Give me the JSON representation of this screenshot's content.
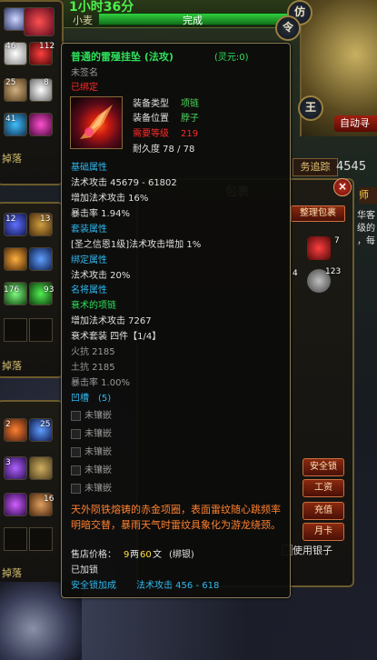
{
  "colors": {
    "title": "#2ee05a",
    "section": "#30b8f0",
    "required_level": "#ff2a2a",
    "description": "#ff8030",
    "price": "#ffe040"
  },
  "top_quest": {
    "timer": "1小时36分",
    "name": "小麦",
    "status": "完成"
  },
  "minimap": {
    "buttons": [
      "仿",
      "令",
      "王"
    ],
    "auto_button": "自动寻",
    "trace_tab": "务追踪",
    "number": "4545"
  },
  "bag": {
    "title": "包裹",
    "sort_button": "整理包裹",
    "tab1": "",
    "tab2": ""
  },
  "left_panel": {
    "drop_label_1": "掉落",
    "drop_label_2": "掉落",
    "drop_label_3": "掉落",
    "counts_top": [
      "46",
      "112",
      "25",
      "8",
      "41"
    ],
    "counts_mid": [
      "12",
      "13",
      "176",
      "93"
    ],
    "counts_bottom": [
      "2",
      "25",
      "3",
      "16"
    ]
  },
  "bag_counts": [
    "4",
    "2",
    "85",
    "2",
    "123",
    "7"
  ],
  "right_side": {
    "tab": "师",
    "text_1": "华客",
    "text_2": "级的",
    "text_3": "，每"
  },
  "side_buttons": [
    "安全锁",
    "工资",
    "充值",
    "月卡"
  ],
  "bottom_bar": {
    "use_silver": "使用银子"
  },
  "tooltip": {
    "title": "普通的雷殛挂坠 (法攻)",
    "spirit": "(灵元:0)",
    "unsigned": "未签名",
    "bound": "已绑定",
    "equip_type_label": "装备类型",
    "equip_type_value": "项链",
    "equip_pos_label": "装备位置",
    "equip_pos_value": "脖子",
    "req_level_label": "需要等级",
    "req_level_value": "219",
    "durability": "耐久度 78 / 78",
    "base_header": "基础属性",
    "base_1": "法术攻击 45679 - 61802",
    "base_2": "增加法术攻击 16%",
    "base_3": "暴击率  1.94%",
    "set_header": "套装属性",
    "set_1": "[圣之信恩1级]法术攻击增加 1%",
    "bind_header": "绑定属性",
    "bind_1": "法术攻击 20%",
    "famous_header": "名将属性",
    "famous_name": "衰术的项链",
    "famous_1": "增加法术攻击 7267",
    "famous_2": "衰术套装 四件【1/4】",
    "famous_3": "火抗 2185",
    "famous_4": "土抗 2185",
    "famous_5": "暴击率 1.00%",
    "groove_header": "凹槽",
    "groove_count": "(5)",
    "unset": [
      "未镶嵌",
      "未镶嵌",
      "未镶嵌",
      "未镶嵌",
      "未镶嵌"
    ],
    "description": "天外陨铁熔铸的赤金项圈，表面雷纹随心跳频率明暗交替，暴雨天气时雷纹具象化为游龙绕颈。",
    "price_label": "售店价格：",
    "price_liang": "9",
    "price_unit_1": "两",
    "price_wen": "60",
    "price_unit_2": "文",
    "price_bind": "(绑银)",
    "locked": "已加锁",
    "safety_lock": "安全锁加成",
    "safety_value": "法术攻击  456 - 618"
  }
}
